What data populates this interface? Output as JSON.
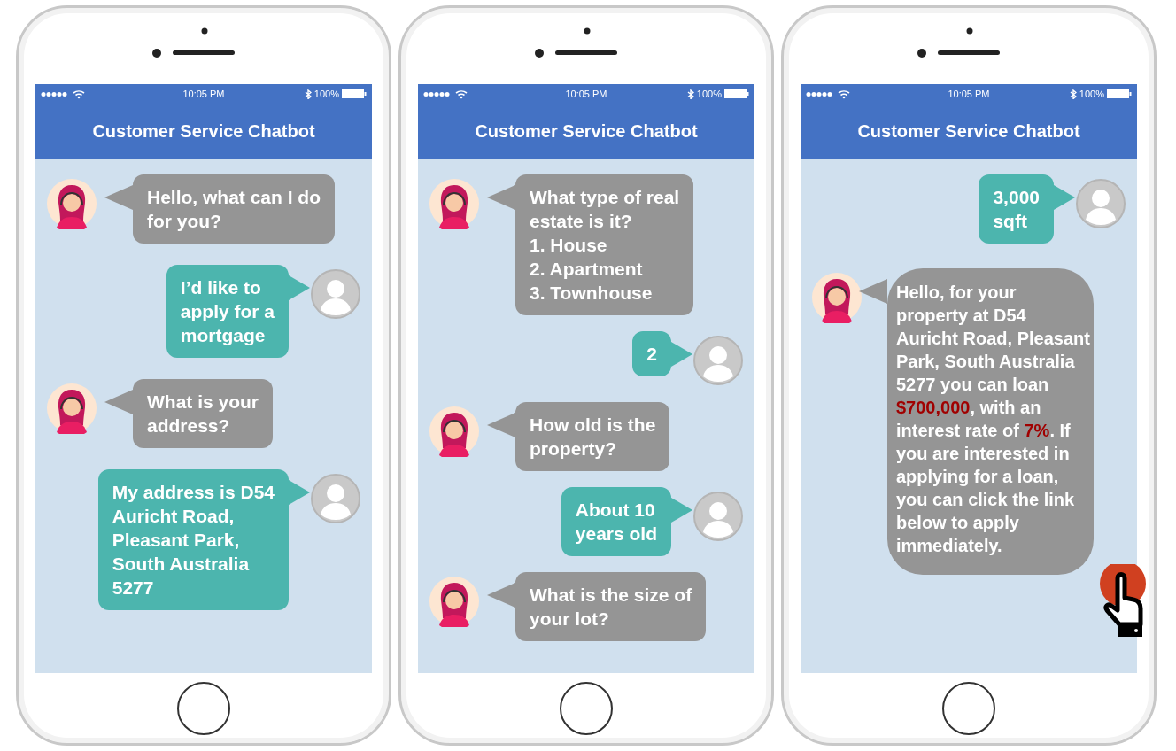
{
  "phones": [
    {
      "status_bar": {
        "time": "10:05 PM",
        "battery": "100%"
      },
      "header": {
        "title": "Customer Service Chatbot"
      },
      "pointer_shown": false,
      "messages": [
        {
          "kind": "bot",
          "text": "Hello, what can I do\nfor you?"
        },
        {
          "kind": "user",
          "text": "I’d like to\napply for a\nmortgage"
        },
        {
          "kind": "bot",
          "text": "What is your\naddress?"
        },
        {
          "kind": "user",
          "text": "My address is D54\nAuricht Road,\nPleasant Park,\nSouth Australia\n5277"
        }
      ]
    },
    {
      "status_bar": {
        "time": "10:05 PM",
        "battery": "100%"
      },
      "header": {
        "title": "Customer Service Chatbot"
      },
      "pointer_shown": false,
      "messages": [
        {
          "kind": "bot",
          "text": "What type of real\nestate is it?\n1. House\n2. Apartment\n3. Townhouse"
        },
        {
          "kind": "user",
          "text": "2"
        },
        {
          "kind": "bot",
          "text": "How old is the\nproperty?"
        },
        {
          "kind": "user",
          "text": "About 10\nyears old"
        },
        {
          "kind": "bot",
          "text": "What is the size of\nyour lot?"
        }
      ]
    },
    {
      "status_bar": {
        "time": "10:05 PM",
        "battery": "100%"
      },
      "header": {
        "title": "Customer Service Chatbot"
      },
      "pointer_shown": true,
      "messages": [
        {
          "kind": "user",
          "text": "3,000\nsqft"
        },
        {
          "kind": "bot",
          "text": "Hello, for your\nproperty at D54\nAuricht Road, Pleasant\nPark, South Australia\n5277 you can loan\n**$700,000**, with an\ninterest rate of **7%**. If\nyou are interested in\napplying for a loan,\nyou can click the link\nbelow to apply\nimmediately."
        }
      ]
    }
  ]
}
